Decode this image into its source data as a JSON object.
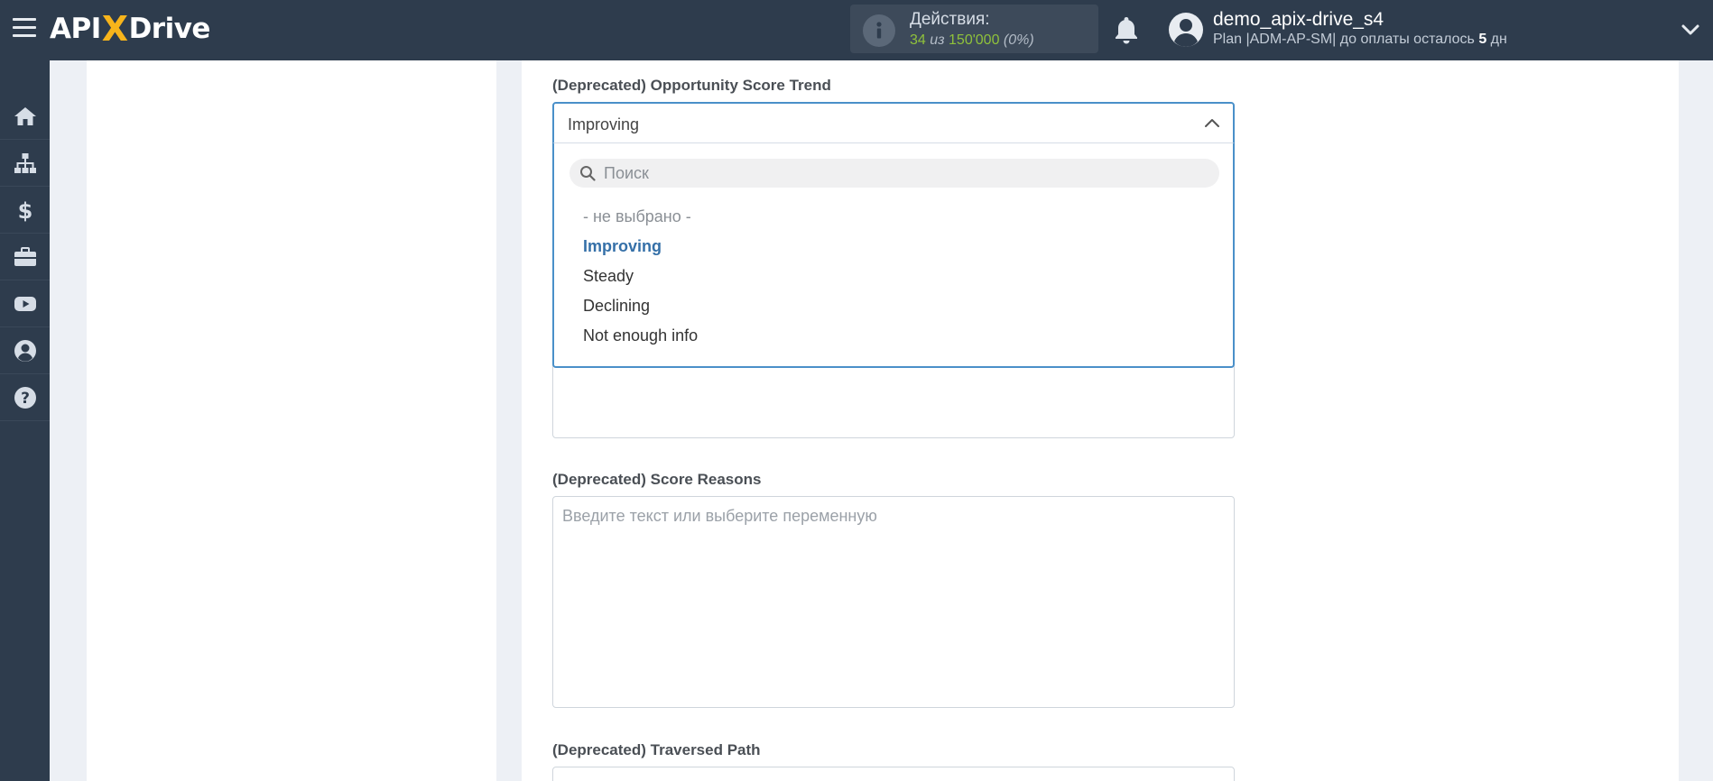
{
  "header": {
    "logo": {
      "part1": "API",
      "x": "X",
      "part2": "Drive"
    },
    "actions": {
      "title": "Действия:",
      "used": "34",
      "of": " из ",
      "total": "150'000",
      "percent": " (0%)"
    },
    "user": {
      "name": "demo_apix-drive_s4",
      "plan_prefix": "Plan |ADM-AP-SM| до оплаты осталось ",
      "days": "5",
      "days_suffix": " дн"
    }
  },
  "sidebar": {
    "items": [
      "home-icon",
      "sitemap-icon",
      "dollar-icon",
      "briefcase-icon",
      "youtube-icon",
      "user-icon",
      "help-icon"
    ]
  },
  "form": {
    "opportunity_trend": {
      "label": "(Deprecated) Opportunity Score Trend",
      "value": "Improving",
      "search_placeholder": "Поиск",
      "options": [
        "- не выбрано -",
        "Improving",
        "Steady",
        "Declining",
        "Not enough info"
      ],
      "selected_index": 1
    },
    "score_reasons": {
      "label": "(Deprecated) Score Reasons",
      "placeholder": "Введите текст или выберите переменную"
    },
    "traversed_path": {
      "label": "(Deprecated) Traversed Path"
    }
  },
  "colors": {
    "topbar": "#2e3c4d",
    "accent": "#4a90c9",
    "active_option": "#3570a8",
    "logo_x": "#f7b41b",
    "actions_used": "#8fc13b"
  }
}
